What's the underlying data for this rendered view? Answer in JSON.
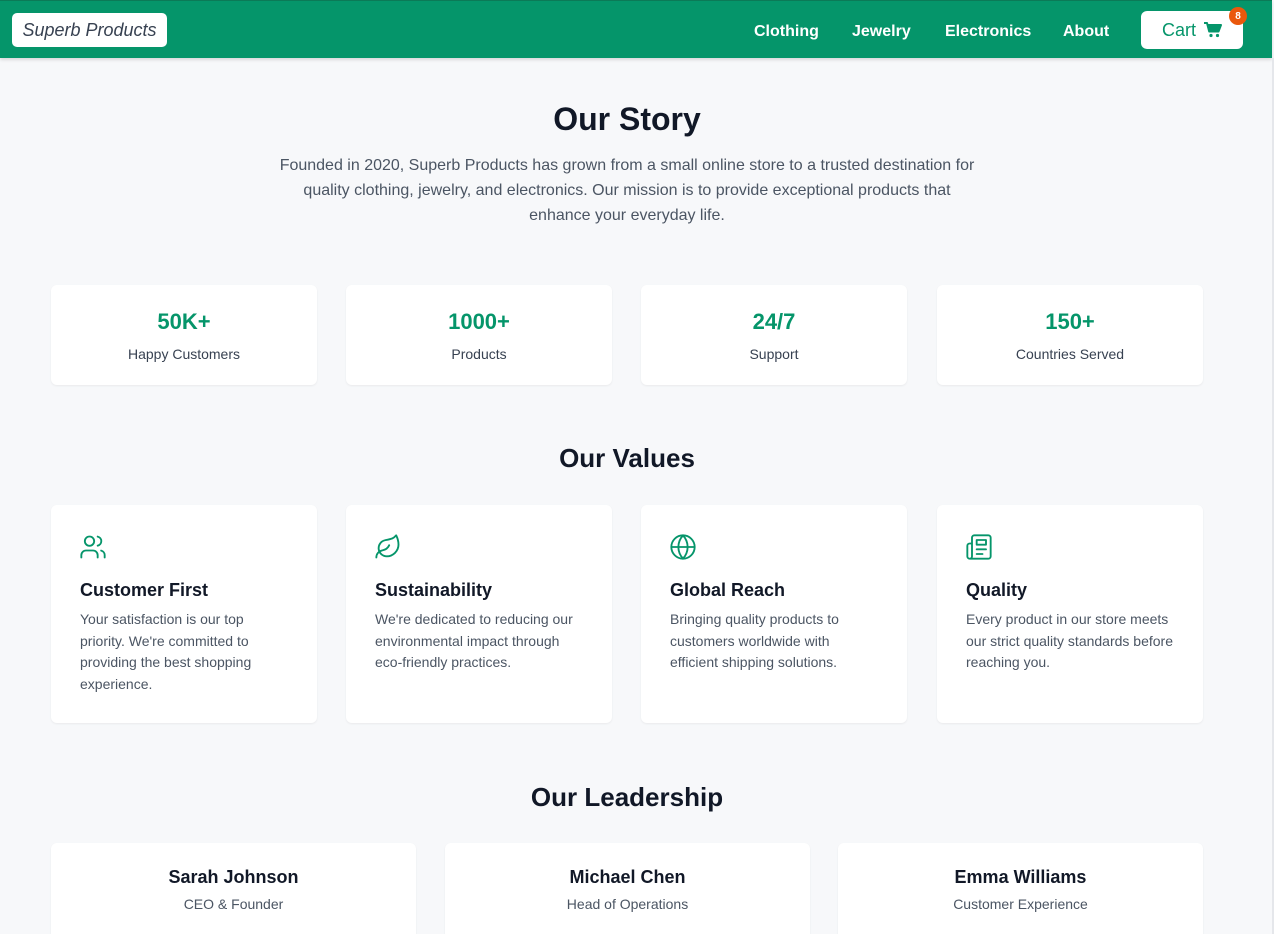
{
  "brand": {
    "name": "Superb Products"
  },
  "nav": {
    "links": [
      "Clothing",
      "Jewelry",
      "Electronics",
      "About"
    ],
    "cart_label": "Cart",
    "cart_count": "8"
  },
  "story": {
    "title": "Our Story",
    "text": "Founded in 2020, Superb Products has grown from a small online store to a trusted destination for quality clothing, jewelry, and electronics. Our mission is to provide exceptional products that enhance your everyday life."
  },
  "stats": [
    {
      "value": "50K+",
      "label": "Happy Customers"
    },
    {
      "value": "1000+",
      "label": "Products"
    },
    {
      "value": "24/7",
      "label": "Support"
    },
    {
      "value": "150+",
      "label": "Countries Served"
    }
  ],
  "values": {
    "title": "Our Values",
    "items": [
      {
        "icon": "users-icon",
        "title": "Customer First",
        "desc": "Your satisfaction is our top priority. We're committed to providing the best shopping experience."
      },
      {
        "icon": "leaf-icon",
        "title": "Sustainability",
        "desc": "We're dedicated to reducing our environmental impact through eco-friendly practices."
      },
      {
        "icon": "globe-icon",
        "title": "Global Reach",
        "desc": "Bringing quality products to customers worldwide with efficient shipping solutions."
      },
      {
        "icon": "newspaper-icon",
        "title": "Quality",
        "desc": "Every product in our store meets our strict quality standards before reaching you."
      }
    ]
  },
  "leadership": {
    "title": "Our Leadership",
    "members": [
      {
        "name": "Sarah Johnson",
        "role": "CEO & Founder"
      },
      {
        "name": "Michael Chen",
        "role": "Head of Operations"
      },
      {
        "name": "Emma Williams",
        "role": "Customer Experience"
      }
    ]
  },
  "colors": {
    "brand_green": "#05956a",
    "badge_orange": "#ea580c",
    "background": "#f7f8fa"
  }
}
